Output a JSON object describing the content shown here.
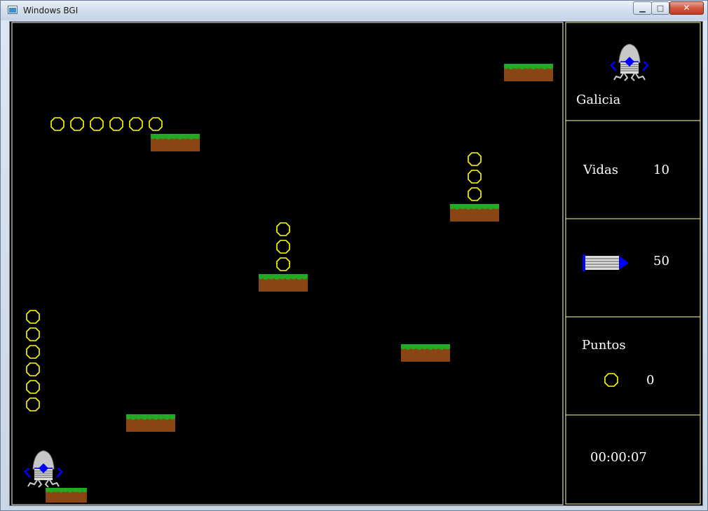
{
  "window": {
    "title": "Windows BGI",
    "minimize_glyph": "▁",
    "maximize_glyph": "□",
    "close_glyph": "✕"
  },
  "hud": {
    "player_name": "Galicia",
    "lives_label": "Vidas",
    "lives_value": "10",
    "ammo_value": "50",
    "points_label": "Puntos",
    "points_value": "0",
    "timer": "00:00:07"
  },
  "colors": {
    "background": "#000000",
    "panel_border": "#ffff99",
    "coin": "#ffff00",
    "grass": "#22aa22",
    "dirt": "#8b4513",
    "robot_body": "#c8c8c8",
    "robot_eye": "#0000ff",
    "text": "#ffffff"
  },
  "icons": [
    "robot-player-icon",
    "bullet-ammo-icon",
    "coin-icon"
  ]
}
